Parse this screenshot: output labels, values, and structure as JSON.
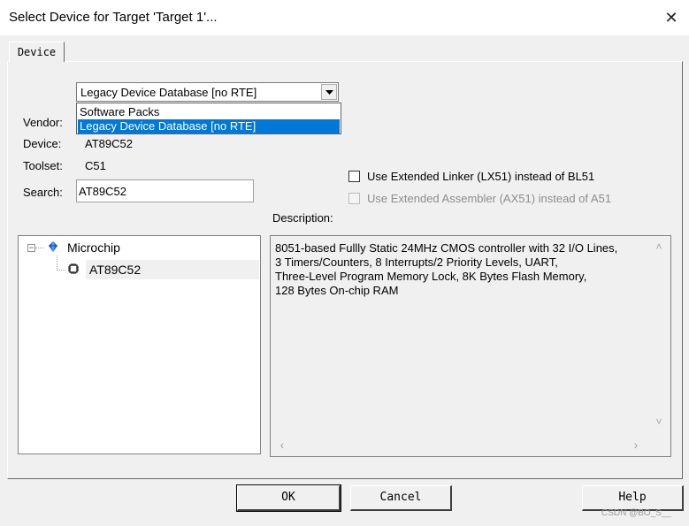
{
  "window": {
    "title": "Select Device for Target 'Target 1'...",
    "close_glyph": "✕"
  },
  "tabs": [
    {
      "label": "Device"
    }
  ],
  "database_select": {
    "value": "Legacy Device Database [no RTE]",
    "options": [
      "Software Packs",
      "Legacy Device Database [no RTE]"
    ],
    "selected_index": 1
  },
  "fields": {
    "vendor_label": "Vendor:",
    "device_label": "Device:",
    "device_value": "AT89C52",
    "toolset_label": "Toolset:",
    "toolset_value": "C51",
    "search_label": "Search:",
    "search_value": "AT89C52"
  },
  "options": {
    "extended_linker": {
      "label": "Use Extended Linker (LX51) instead of BL51",
      "checked": false,
      "enabled": true
    },
    "extended_assembler": {
      "label": "Use Extended Assembler (AX51) instead of A51",
      "checked": false,
      "enabled": false
    }
  },
  "description": {
    "label": "Description:",
    "lines": [
      "8051-based Fullly Static 24MHz CMOS controller with 32  I/O Lines,",
      "3 Timers/Counters, 8 Interrupts/2 Priority Levels, UART,",
      "Three-Level Program Memory Lock, 8K Bytes Flash Memory,",
      "128 Bytes On-chip RAM"
    ]
  },
  "tree": {
    "vendor": "Microchip",
    "device": "AT89C52",
    "expand_glyph": "−",
    "icons": {
      "vendor": "gem-icon",
      "device": "chip-icon"
    }
  },
  "scroll_glyphs": {
    "up": "˄",
    "down": "˅",
    "left": "‹",
    "right": "›"
  },
  "buttons": {
    "ok": "OK",
    "cancel": "Cancel",
    "help": "Help"
  },
  "watermark": "CSDN @BO_S__",
  "colors": {
    "selection": "#0078d7",
    "accent_gem": "#1e63d4"
  }
}
